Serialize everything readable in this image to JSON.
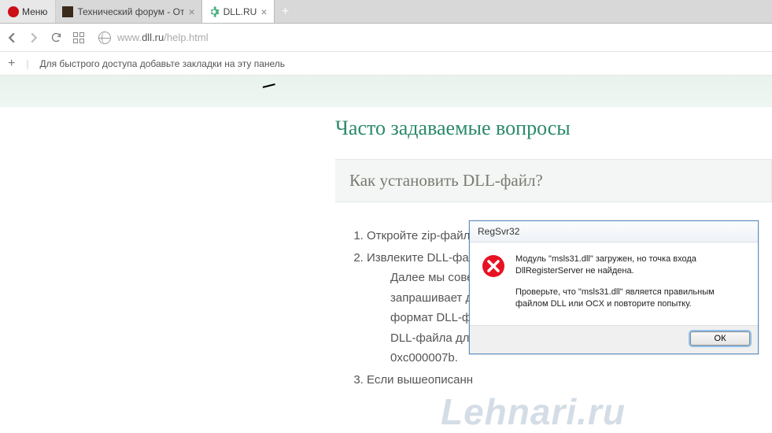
{
  "browser": {
    "menu_label": "Меню",
    "tabs": [
      {
        "label": "Технический форум - От",
        "active": false
      },
      {
        "label": "DLL.RU",
        "active": true
      }
    ],
    "url_prefix": "www.",
    "url_domain": "dll.ru",
    "url_path": "/help.html",
    "bookmark_hint": "Для быстрого доступа добавьте закладки на эту панель"
  },
  "page": {
    "heading": "Часто задаваемые вопросы",
    "faq_title": "Как установить DLL-файл?",
    "steps": {
      "s1": "Откройте zip-файл",
      "s2": "Извлеките DLL-фа",
      "s2_a": "Далее мы советуе",
      "s2_b": "запрашивает данн",
      "s2_c": "формат DLL-файла",
      "s2_d": "DLL-файла для 64",
      "s2_e": "0xc000007b.",
      "s3": "Если вышеописанн"
    }
  },
  "dialog": {
    "title": "RegSvr32",
    "msg1": "Модуль \"msls31.dll\" загружен, но точка входа DllRegisterServer не найдена.",
    "msg2": "Проверьте, что \"msls31.dll\" является правильным файлом DLL или OCX и повторите попытку.",
    "ok": "ОК"
  },
  "watermark": "Lehnari.ru"
}
